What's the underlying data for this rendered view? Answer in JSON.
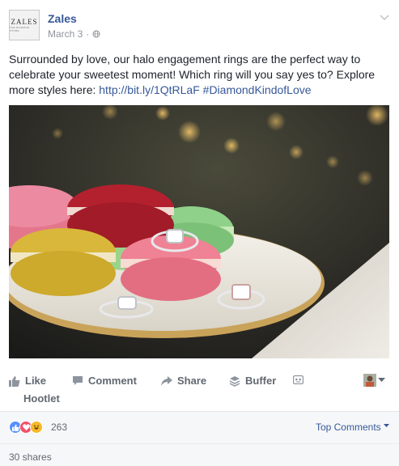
{
  "post": {
    "page_name": "Zales",
    "avatar_logo_text": "ZALES",
    "avatar_logo_subtext": "THE DIAMOND STORE",
    "date": "March 3",
    "separator": "·",
    "text_before_link": "Surrounded by love, our halo engagement rings are the perfect way to celebrate your sweetest moment! Which ring will you say yes to? Explore more styles here: ",
    "link": "http://bit.ly/1QtRLaF",
    "hashtag": "#DiamondKindofLove"
  },
  "actions": {
    "like": "Like",
    "comment": "Comment",
    "share": "Share",
    "buffer": "Buffer",
    "hootlet": "Hootlet"
  },
  "reactions": {
    "count": "263",
    "top_comments": "Top Comments",
    "shares": "30 shares"
  },
  "colors": {
    "link_blue": "#365899",
    "like_blue": "#5890ff",
    "love_red": "#f25268",
    "haha_yellow": "#f7b928"
  },
  "icons": [
    "globe-icon",
    "chevron-down-icon",
    "like-icon",
    "comment-icon",
    "share-icon",
    "buffer-icon",
    "bot-icon",
    "profile-switcher-icon"
  ]
}
